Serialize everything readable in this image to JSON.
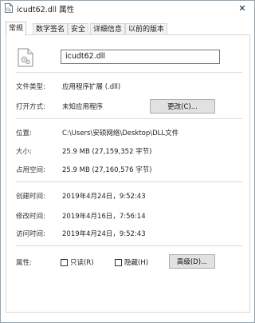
{
  "window": {
    "title": "icudt62.dll 属性",
    "close_glyph": "✕"
  },
  "tabs": [
    {
      "label": "常规",
      "active": true
    },
    {
      "label": "数字签名",
      "active": false
    },
    {
      "label": "安全",
      "active": false
    },
    {
      "label": "详细信息",
      "active": false
    },
    {
      "label": "以前的版本",
      "active": false
    }
  ],
  "general": {
    "filename": "icudt62.dll",
    "file_type_label": "文件类型:",
    "file_type_value": "应用程序扩展 (.dll)",
    "opens_with_label": "打开方式:",
    "opens_with_value": "未知应用程序",
    "change_button": "更改(C)...",
    "location_label": "位置:",
    "location_value": "C:\\Users\\安硕网络\\Desktop\\DLL文件",
    "size_label": "大小:",
    "size_value": "25.9 MB (27,159,352 字节)",
    "size_on_disk_label": "占用空间:",
    "size_on_disk_value": "25.9 MB (27,160,576 字节)",
    "created_label": "创建时间:",
    "created_value": "2019年4月24日，9:52:43",
    "modified_label": "修改时间:",
    "modified_value": "2019年4月16日，7:56:14",
    "accessed_label": "访问时间:",
    "accessed_value": "2019年4月24日，9:52:43",
    "attributes_label": "属性:",
    "readonly_label": "只读(R)",
    "readonly_checked": false,
    "hidden_label": "隐藏(H)",
    "hidden_checked": false,
    "advanced_button": "高级(D)..."
  }
}
